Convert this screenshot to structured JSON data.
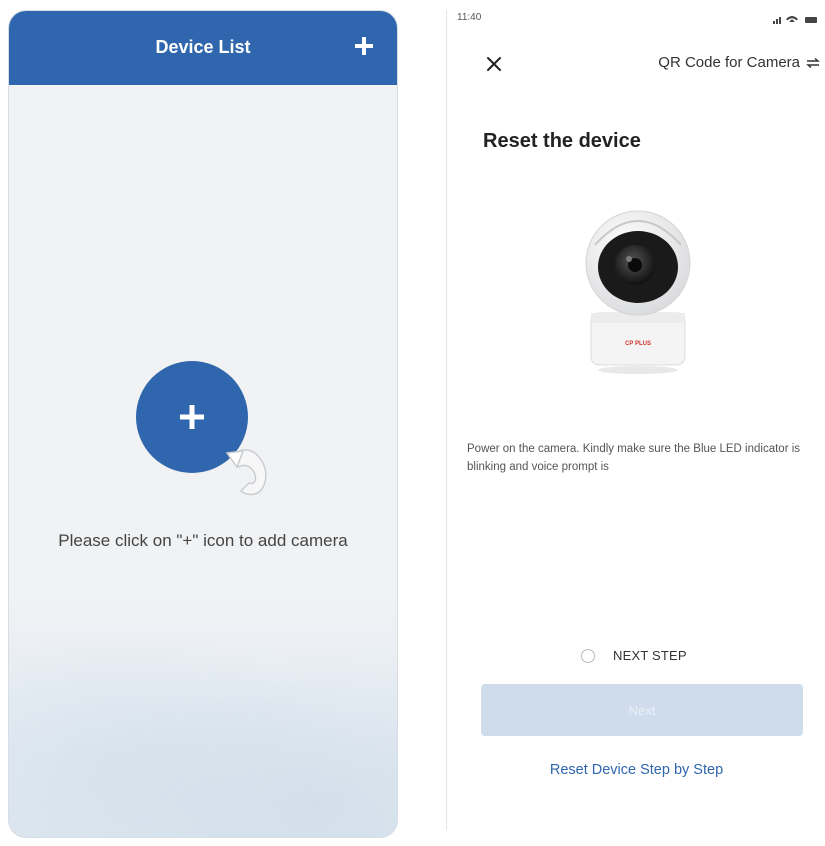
{
  "left": {
    "header": {
      "title": "Device List",
      "add_icon": "plus-icon"
    },
    "hint": "Please click on \"+\" icon to add camera",
    "big_add_icon": "plus-icon",
    "hand_icon": "pointing-hand-icon"
  },
  "right": {
    "status_bar": {
      "time": "11:40"
    },
    "top_bar": {
      "close_icon": "close-icon",
      "qr_link": "QR Code for Camera",
      "qr_icon": "switch-icon"
    },
    "heading": "Reset the device",
    "camera_brand": "CP PLUS",
    "description": "Power on the camera. Kindly make sure the Blue LED indicator is blinking and voice prompt is",
    "next_step_label": "NEXT STEP",
    "next_button_label": "Next",
    "reset_link": "Reset Device Step by Step"
  },
  "colors": {
    "primary": "#2f66ad",
    "button_disabled": "#cfdcec"
  }
}
